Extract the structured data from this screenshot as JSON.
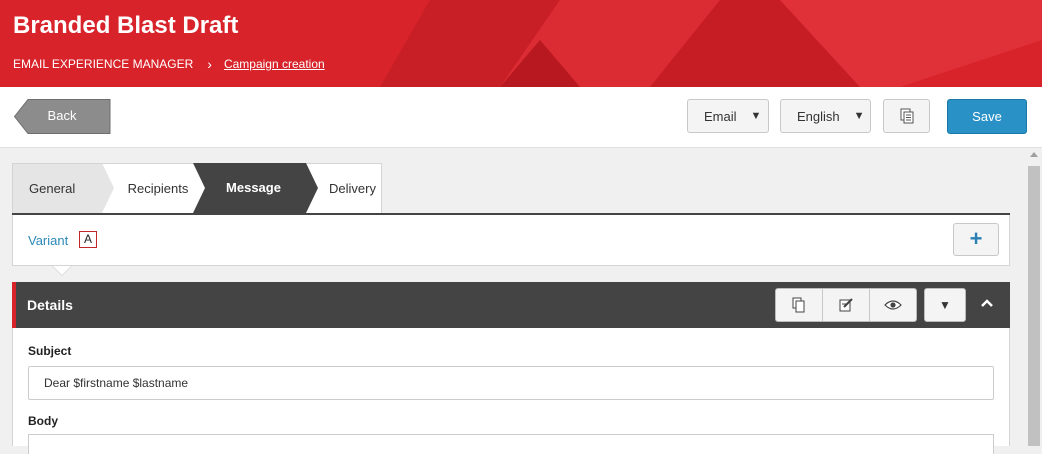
{
  "header": {
    "title": "Branded Blast Draft",
    "breadcrumb": {
      "root": "EMAIL EXPERIENCE MANAGER",
      "separator": "›",
      "current": "Campaign creation"
    },
    "color": "#d8232a"
  },
  "toolbar": {
    "back_label": "Back",
    "channel_select": "Email",
    "language_select": "English",
    "copy_icon": "copy-icon",
    "save_label": "Save"
  },
  "tabs": [
    {
      "label": "General"
    },
    {
      "label": "Recipients"
    },
    {
      "label": "Message",
      "active": true
    },
    {
      "label": "Delivery"
    }
  ],
  "variant": {
    "label": "Variant",
    "value": "A",
    "add_label": "+"
  },
  "details": {
    "title": "Details",
    "actions": [
      "copy-icon",
      "edit-icon",
      "eye-icon"
    ],
    "dropdown_label": "▼",
    "collapse_icon": "chevron-up-icon",
    "subject_label": "Subject",
    "subject_value": "Dear $firstname $lastname",
    "body_label": "Body"
  }
}
